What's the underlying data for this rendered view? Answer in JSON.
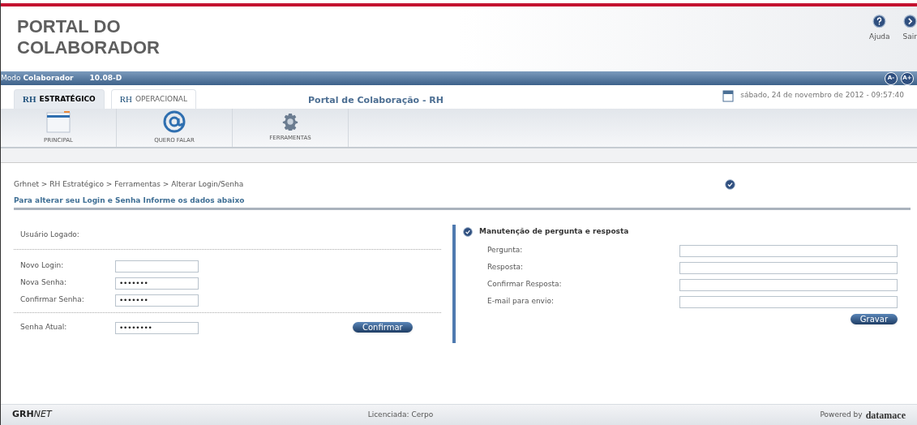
{
  "header": {
    "title_line1": "PORTAL DO",
    "title_line2": "COLABORADOR",
    "actions": [
      {
        "kind": "help",
        "label": "Ajuda"
      },
      {
        "kind": "exit",
        "label": "Sair"
      }
    ]
  },
  "mode_bar": {
    "prefix": "Modo",
    "mode": "Colaborador",
    "version": "10.08-D",
    "font_buttons": [
      "A-",
      "A+"
    ]
  },
  "tabs": [
    {
      "prefix": "RH",
      "label": "ESTRATÉGICO",
      "selected": true
    },
    {
      "prefix": "RH",
      "label": "OPERACIONAL",
      "selected": false
    }
  ],
  "portal_title": "Portal de Colaboração - RH",
  "date": "sábado, 24 de novembro de 2012 - 09:57:40",
  "toolbar": [
    {
      "kind": "window",
      "label": "PRINCIPAL"
    },
    {
      "kind": "at",
      "label": "QUERO FALAR"
    },
    {
      "kind": "gear",
      "label": "FERRAMENTAS"
    }
  ],
  "breadcrumb": "Grhnet > RH Estratégico > Ferramentas > Alterar Login/Senha",
  "instruction": "Para alterar seu Login e Senha Informe os dados abaixo",
  "login_form": {
    "user_label": "Usuário Logado:",
    "fields": [
      {
        "label": "Novo Login:"
      },
      {
        "label": "Nova Senha:",
        "value": "•••••••"
      },
      {
        "label": "Confirmar Senha:",
        "value": "•••••••"
      }
    ],
    "current": {
      "label": "Senha Atual:",
      "value": "••••••••"
    },
    "button": "Confirmar"
  },
  "qa_form": {
    "title": "Manutenção de pergunta e resposta",
    "fields": [
      {
        "label": "Pergunta:"
      },
      {
        "label": "Resposta:"
      },
      {
        "label": "Confirmar Resposta:"
      },
      {
        "label": "E-mail para envio:"
      }
    ],
    "button": "Gravar"
  },
  "footer": {
    "logo_bold": "GRH",
    "logo_italic": "NET",
    "license": "Licenciada: Cerpo",
    "powered_by": "Powered by",
    "brand": "datamace"
  }
}
